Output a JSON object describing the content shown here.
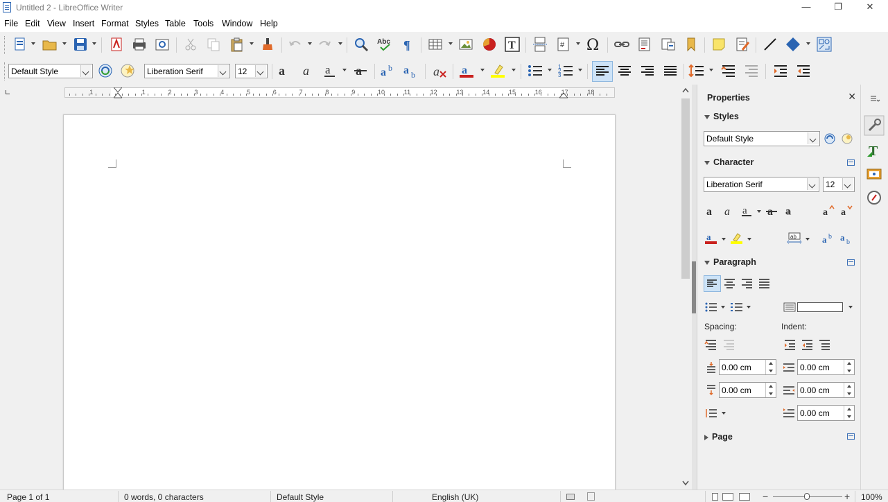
{
  "window": {
    "title": "Untitled 2 - LibreOffice Writer",
    "minimize": "—",
    "restore": "❐",
    "close": "✕"
  },
  "menu": [
    "File",
    "Edit",
    "View",
    "Insert",
    "Format",
    "Styles",
    "Table",
    "Tools",
    "Window",
    "Help"
  ],
  "formatting": {
    "paragraph_style": "Default Style",
    "font_name": "Liberation Serif",
    "font_size": "12"
  },
  "ruler": {
    "numbers": [
      "1",
      "1",
      "2",
      "3",
      "4",
      "5",
      "6",
      "7",
      "8",
      "9",
      "10",
      "11",
      "12",
      "13",
      "14",
      "15",
      "16",
      "17",
      "18"
    ]
  },
  "sidebar": {
    "title": "Properties",
    "close": "✕",
    "styles": {
      "header": "Styles",
      "style_value": "Default Style"
    },
    "character": {
      "header": "Character",
      "font_name": "Liberation Serif",
      "font_size": "12"
    },
    "paragraph": {
      "header": "Paragraph",
      "spacing_label": "Spacing:",
      "indent_label": "Indent:",
      "above_spacing": "0.00 cm",
      "below_spacing": "0.00 cm",
      "before_indent": "0.00 cm",
      "after_indent": "0.00 cm",
      "first_line_indent": "0.00 cm"
    },
    "page": {
      "header": "Page"
    }
  },
  "status": {
    "page": "Page 1 of 1",
    "words": "0 words, 0 characters",
    "page_style": "Default Style",
    "language": "English (UK)",
    "zoom": "100%"
  },
  "colors": {
    "font_color": "#c9211e",
    "highlight_color": "#ffff00",
    "accent_blue": "#2a64b2",
    "selection_bg": "#cde3f7"
  }
}
